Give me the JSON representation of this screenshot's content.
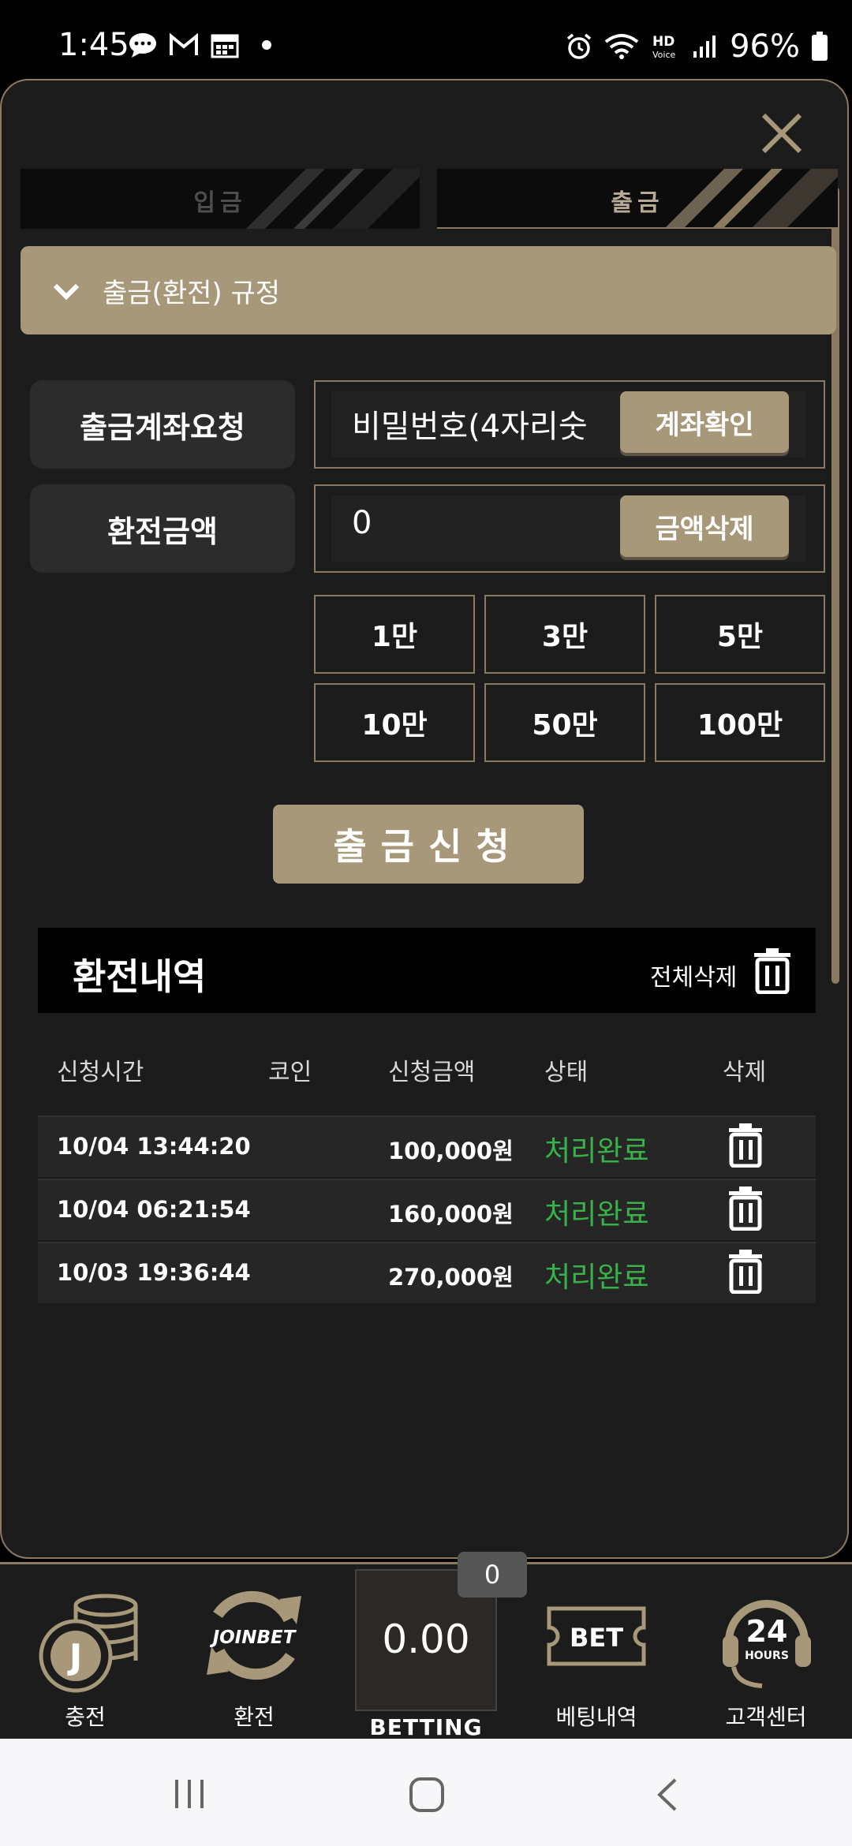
{
  "status_bar": {
    "time": "1:45",
    "battery": "96%"
  },
  "tabs": {
    "deposit": "입금",
    "withdraw": "출금"
  },
  "rules": {
    "label": "출금(환전) 규정"
  },
  "form": {
    "account_label": "출금계좌요청",
    "account_placeholder": "비밀번호(4자리숫",
    "account_button": "계좌확인",
    "amount_label": "환전금액",
    "amount_value": "0",
    "amount_clear_button": "금액삭제",
    "quick_amounts": [
      "1만",
      "3만",
      "5만",
      "10만",
      "50만",
      "100만"
    ],
    "submit": "출금신청"
  },
  "history": {
    "title": "환전내역",
    "delete_all": "전체삭제",
    "columns": [
      "신청시간",
      "코인",
      "신청금액",
      "상태",
      "삭제"
    ],
    "rows": [
      {
        "time": "10/04 13:44:20",
        "coin": "",
        "amount": "100,000원",
        "status": "처리완료"
      },
      {
        "time": "10/04 06:21:54",
        "coin": "",
        "amount": "160,000원",
        "status": "처리완료"
      },
      {
        "time": "10/03 19:36:44",
        "coin": "",
        "amount": "270,000원",
        "status": "처리완료"
      }
    ],
    "status_color": "#37b34a"
  },
  "bottom_nav": {
    "charge": "충전",
    "exchange": "환전",
    "exchange_logo": "JOINBET",
    "betting_value": "0.00",
    "betting_badge": "0",
    "betting_label": "BETTING",
    "bet_history": "베팅내역",
    "bet_logo": "BET",
    "support": "고객센터",
    "support_logo_big": "24",
    "support_logo_small": "HOURS"
  },
  "colors": {
    "accent": "#a8987a",
    "border": "#8a7a60",
    "background": "#1c1c1c"
  }
}
